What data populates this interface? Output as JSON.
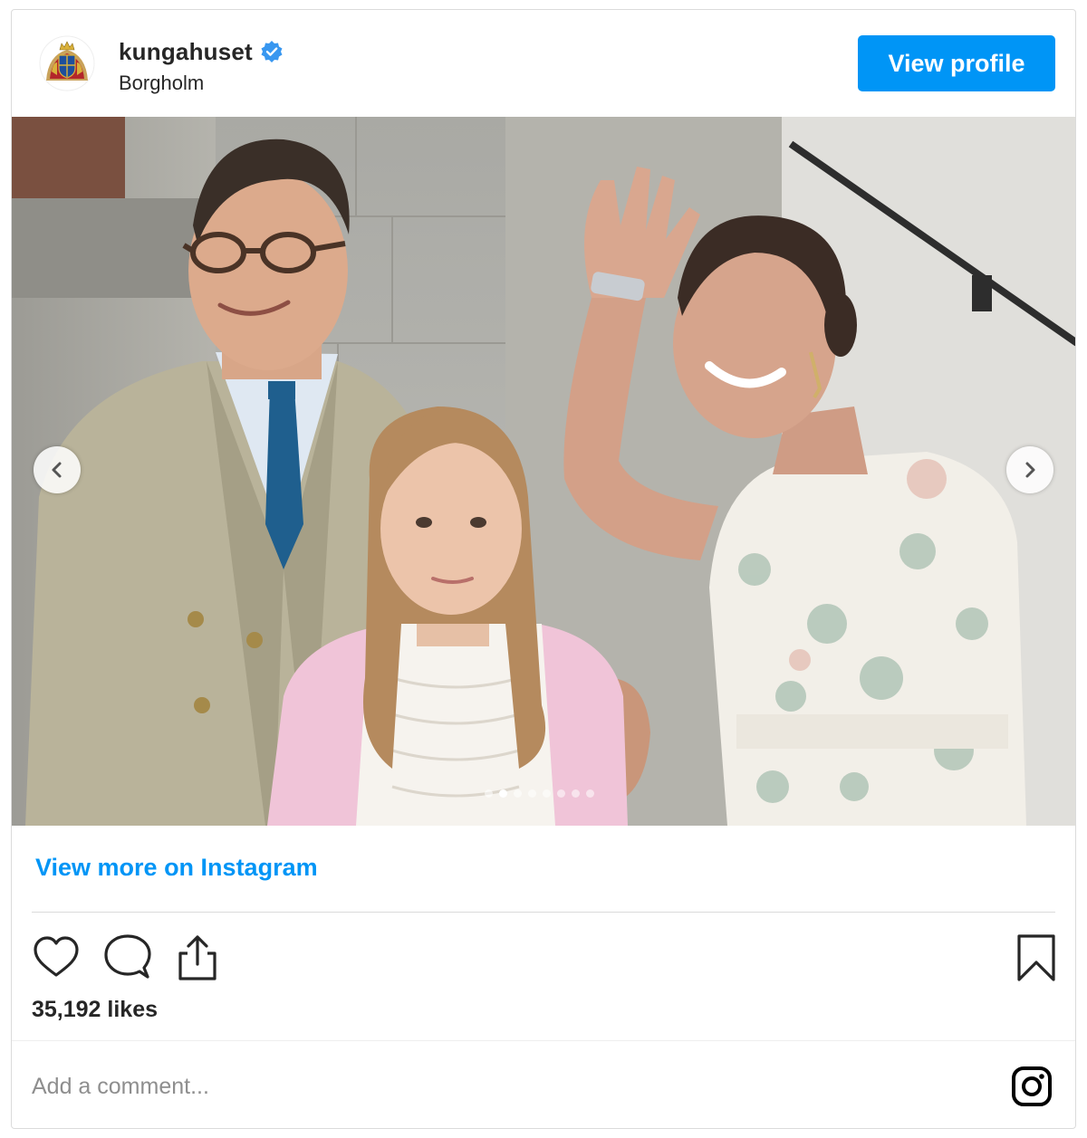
{
  "header": {
    "username": "kungahuset",
    "location": "Borgholm",
    "view_profile_label": "View profile",
    "verified_icon": "verified-badge-icon",
    "avatar_icon": "royal-coat-of-arms"
  },
  "photo": {
    "carousel_dots": 8,
    "active_dot_index": 1,
    "prev_icon": "chevron-left-icon",
    "next_icon": "chevron-right-icon"
  },
  "links": {
    "view_more": "View more on Instagram"
  },
  "actions": {
    "like_icon": "heart-icon",
    "comment_icon": "comment-icon",
    "share_icon": "share-icon",
    "save_icon": "bookmark-icon"
  },
  "likes": {
    "text": "35,192 likes"
  },
  "comment": {
    "placeholder": "Add a comment...",
    "logo_icon": "instagram-icon"
  },
  "colors": {
    "accent": "#0095f6",
    "text": "#262626",
    "muted": "#8e8e8e",
    "border": "#dbdbdb"
  }
}
